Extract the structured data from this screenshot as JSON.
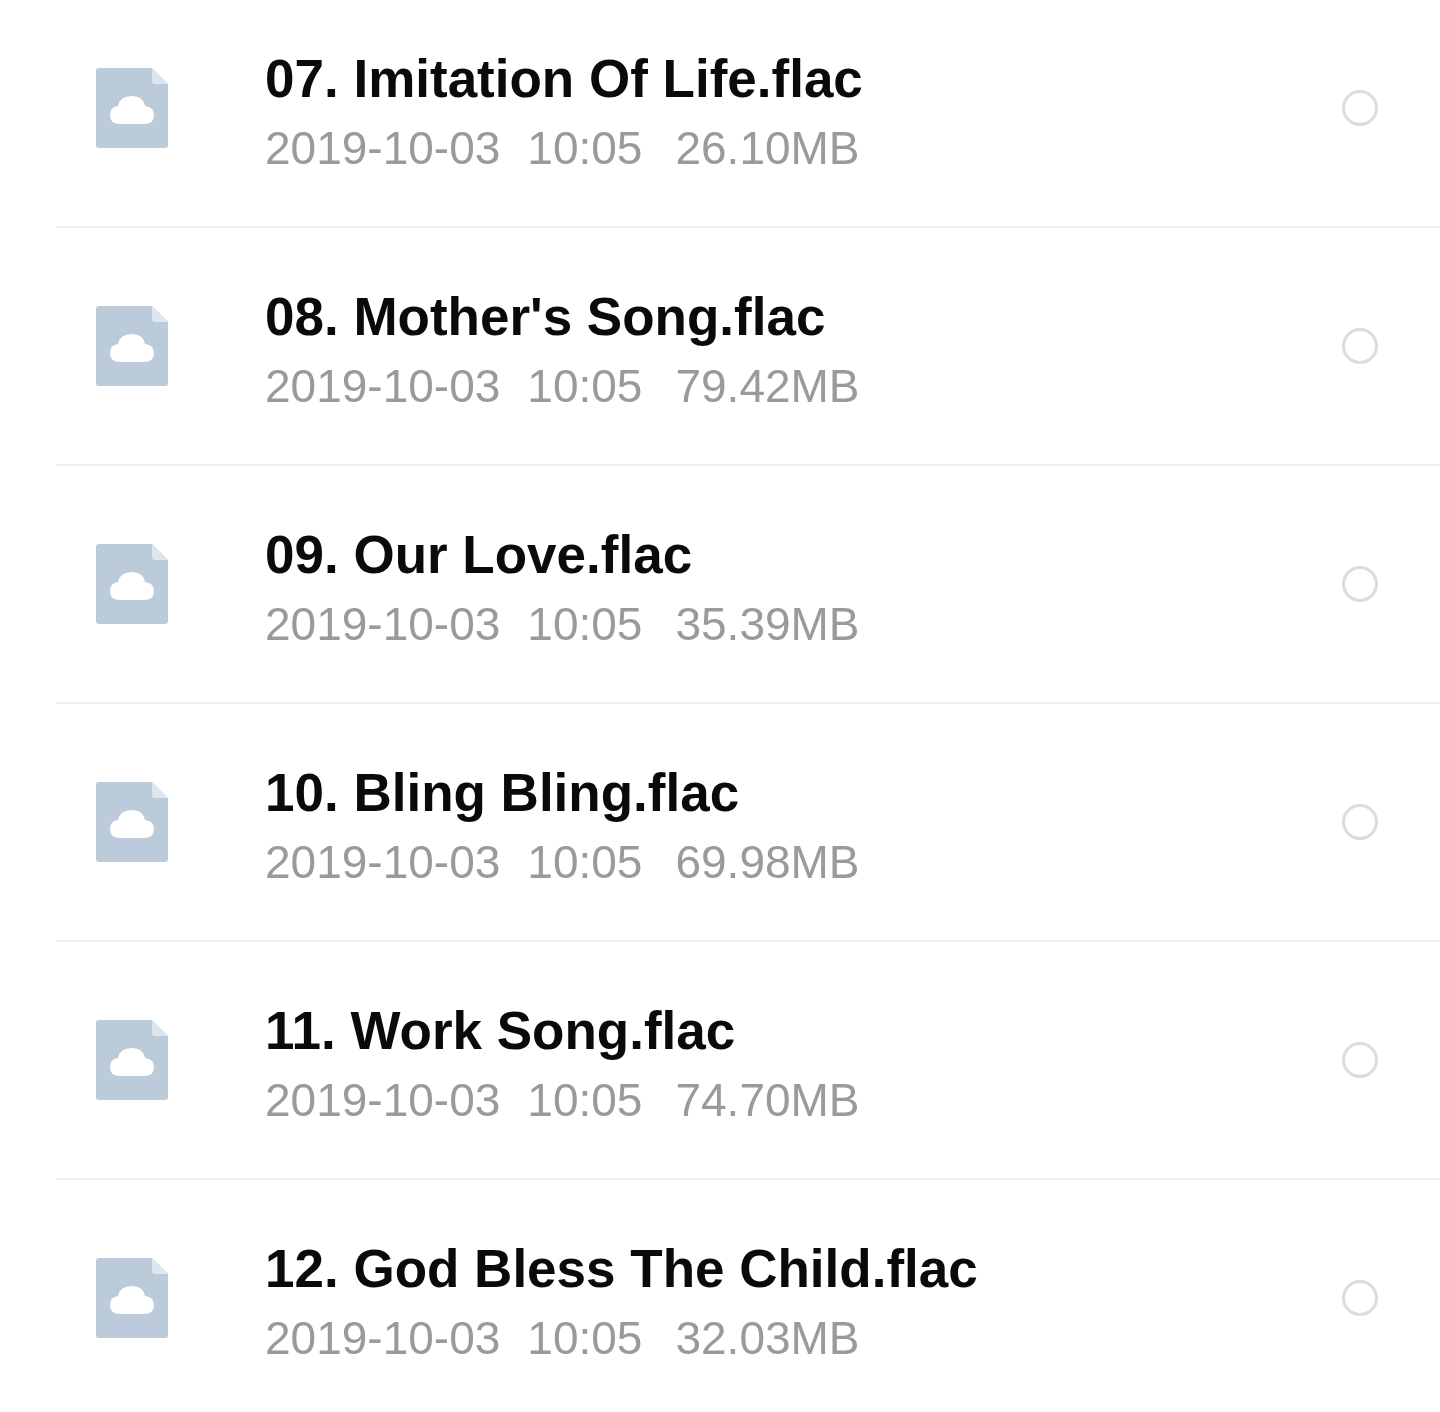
{
  "files": [
    {
      "name": "07. Imitation Of Life.flac",
      "date": "2019-10-03",
      "time": "10:05",
      "size": "26.10MB",
      "selected": false
    },
    {
      "name": "08. Mother's Song.flac",
      "date": "2019-10-03",
      "time": "10:05",
      "size": "79.42MB",
      "selected": false
    },
    {
      "name": "09. Our Love.flac",
      "date": "2019-10-03",
      "time": "10:05",
      "size": "35.39MB",
      "selected": false
    },
    {
      "name": "10. Bling Bling.flac",
      "date": "2019-10-03",
      "time": "10:05",
      "size": "69.98MB",
      "selected": false
    },
    {
      "name": "11. Work Song.flac",
      "date": "2019-10-03",
      "time": "10:05",
      "size": "74.70MB",
      "selected": false
    },
    {
      "name": "12. God Bless The Child.flac",
      "date": "2019-10-03",
      "time": "10:05",
      "size": "32.03MB",
      "selected": false
    }
  ]
}
